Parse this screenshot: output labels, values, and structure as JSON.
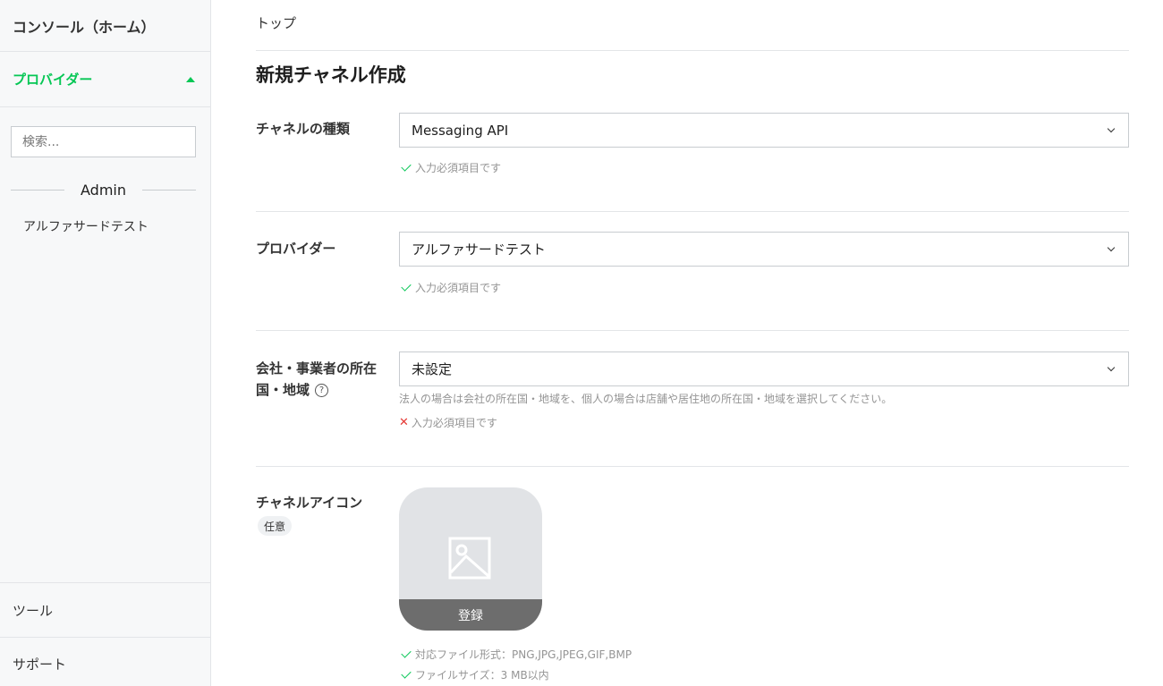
{
  "sidebar": {
    "home": "コンソール（ホーム）",
    "provider_section": "プロバイダー",
    "search_placeholder": "検索...",
    "group_label": "Admin",
    "items": [
      {
        "label": "アルファサードテスト"
      }
    ],
    "tools": "ツール",
    "support": "サポート"
  },
  "breadcrumb": "トップ",
  "page_title": "新規チャネル作成",
  "form": {
    "channel_type": {
      "label": "チャネルの種類",
      "value": "Messaging API",
      "validation": "入力必須項目です"
    },
    "provider": {
      "label": "プロバイダー",
      "value": "アルファサードテスト",
      "validation": "入力必須項目です"
    },
    "country": {
      "label_line1": "会社・事業者の所在",
      "label_line2": "国・地域",
      "value": "未設定",
      "help": "法人の場合は会社の所在国・地域を、個人の場合は店舗や居住地の所在国・地域を選択してください。",
      "validation": "入力必須項目です",
      "help_icon_glyph": "?"
    },
    "channel_icon": {
      "label": "チャネルアイコン",
      "badge": "任意",
      "upload_label": "登録",
      "file_format": "対応ファイル形式：PNG,JPG,JPEG,GIF,BMP",
      "file_size": "ファイルサイズ：3 MB以内"
    }
  },
  "colors": {
    "accent": "#06c755",
    "error": "#e53935"
  }
}
